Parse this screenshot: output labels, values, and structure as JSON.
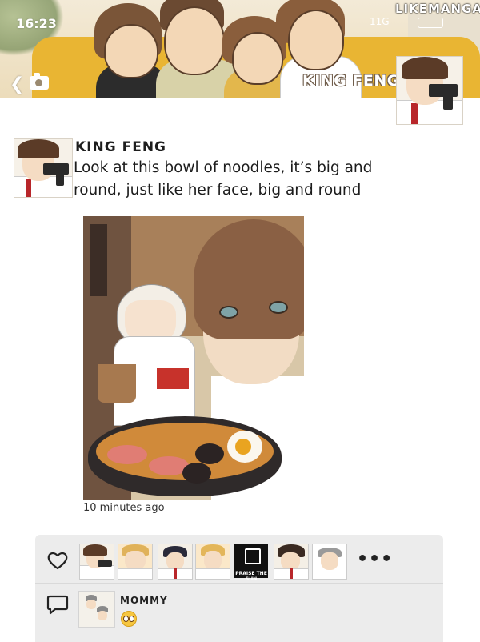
{
  "status_bar": {
    "time": "16:23",
    "network": "11G",
    "battery_icon": "battery-icon"
  },
  "watermark": "LIKEMANGA.IO",
  "profile": {
    "name": "KING FENG",
    "back_icon": "chevron-left-icon",
    "camera_icon": "camera-icon"
  },
  "post": {
    "author": "KING FENG",
    "text": "Look at this bowl of noodles, it’s big and round, just like her face, big and round",
    "timestamp": "10 minutes ago"
  },
  "likes": {
    "heart_icon": "heart-icon",
    "more_label": "•••",
    "praise_label": "PRAISE THE SUN"
  },
  "comments": [
    {
      "author": "MOMMY",
      "emoji": "flushed-face-emoji"
    }
  ],
  "colors": {
    "panel_bg": "#ececec",
    "sofa": "#e9b533",
    "text": "#1c1c1c"
  }
}
